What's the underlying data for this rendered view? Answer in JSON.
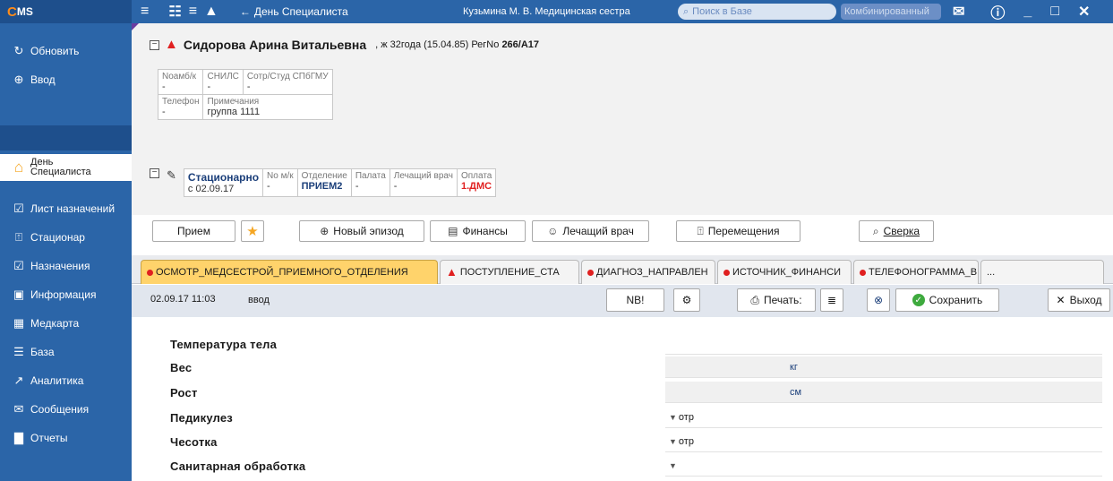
{
  "app": {
    "logo_c": "C",
    "logo_ms": "MS"
  },
  "sidebar": {
    "items": [
      {
        "label": "Обновить",
        "icon": "refresh-icon"
      },
      {
        "label": "Ввод",
        "icon": "plus-circle-icon"
      },
      {
        "label": "День Специалиста",
        "icon": "home-icon",
        "active": true
      },
      {
        "label": "Лист назначений",
        "icon": "checkbox-icon"
      },
      {
        "label": "Стационар",
        "icon": "bed-icon"
      },
      {
        "label": "Назначения",
        "icon": "checkbox-icon"
      },
      {
        "label": "Информация",
        "icon": "info-card-icon"
      },
      {
        "label": "Медкарта",
        "icon": "grid-icon"
      },
      {
        "label": "База",
        "icon": "database-icon"
      },
      {
        "label": "Аналитика",
        "icon": "chart-icon"
      },
      {
        "label": "Сообщения",
        "icon": "mail-icon"
      },
      {
        "label": "Отчеты",
        "icon": "report-icon"
      }
    ],
    "active_label_line1": "День",
    "active_label_line2": "Специалиста"
  },
  "topbar": {
    "back_label": "День Специалиста",
    "user": "Кузьмина М. В. Медицинская сестра",
    "search_placeholder": "Поиск в Базе",
    "combo_label": "Комбинированный"
  },
  "patient": {
    "name": "Сидорова Арина Витальевна",
    "info_prefix": ", ж 32года (15.04.85) РегNo",
    "reg_no": "266/A17",
    "fields": {
      "amb_label": "Noамб/к",
      "amb_value": "-",
      "snils_label": "СНИЛС",
      "snils_value": "-",
      "staff_label": "Сотр/Студ СПбГМУ",
      "staff_value": "-",
      "phone_label": "Телефон",
      "phone_value": "-",
      "notes_label": "Примечания",
      "notes_value": "группа 1111"
    },
    "stay": {
      "type": "Стационарно",
      "since": "с 02.09.17",
      "mk_label": "No м/к",
      "mk_value": "-",
      "dept_label": "Отделение",
      "dept_value": "ПРИЕМ2",
      "ward_label": "Палата",
      "ward_value": "-",
      "doctor_label": "Лечащий врач",
      "doctor_value": "-",
      "payment_label": "Оплата",
      "payment_value": "1.ДМС"
    }
  },
  "actions": {
    "reception": "Прием",
    "new_episode": "Новый эпизод",
    "finance": "Финансы",
    "doctor": "Лечащий врач",
    "moves": "Перемещения",
    "reconcile": "Сверка"
  },
  "tabs": [
    {
      "label": "ОСМОТР_МЕДСЕСТРОЙ_ПРИЕМНОГО_ОТДЕЛЕНИЯ"
    },
    {
      "label": "ПОСТУПЛЕНИЕ_СТА"
    },
    {
      "label": "ДИАГНОЗ_НАПРАВЛЕН"
    },
    {
      "label": "ИСТОЧНИК_ФИНАНСИ"
    },
    {
      "label": "ТЕЛЕФОНОГРАММА_В"
    },
    {
      "label": "..."
    }
  ],
  "toolbar": {
    "datetime": "02.09.17 11:03",
    "mode": "ввод",
    "nb": "NB!",
    "print": "Печать:",
    "save": "Сохранить",
    "exit": "Выход"
  },
  "form": {
    "rows": [
      {
        "label": "Температура тела",
        "value": "",
        "unit": ""
      },
      {
        "label": "Вес",
        "value": "",
        "unit": "кг"
      },
      {
        "label": "Рост",
        "value": "",
        "unit": "см"
      },
      {
        "label": "Педикулез",
        "value": "отр",
        "unit": ""
      },
      {
        "label": "Чесотка",
        "value": "отр",
        "unit": ""
      },
      {
        "label": "Санитарная обработка",
        "value": "",
        "unit": ""
      }
    ]
  }
}
